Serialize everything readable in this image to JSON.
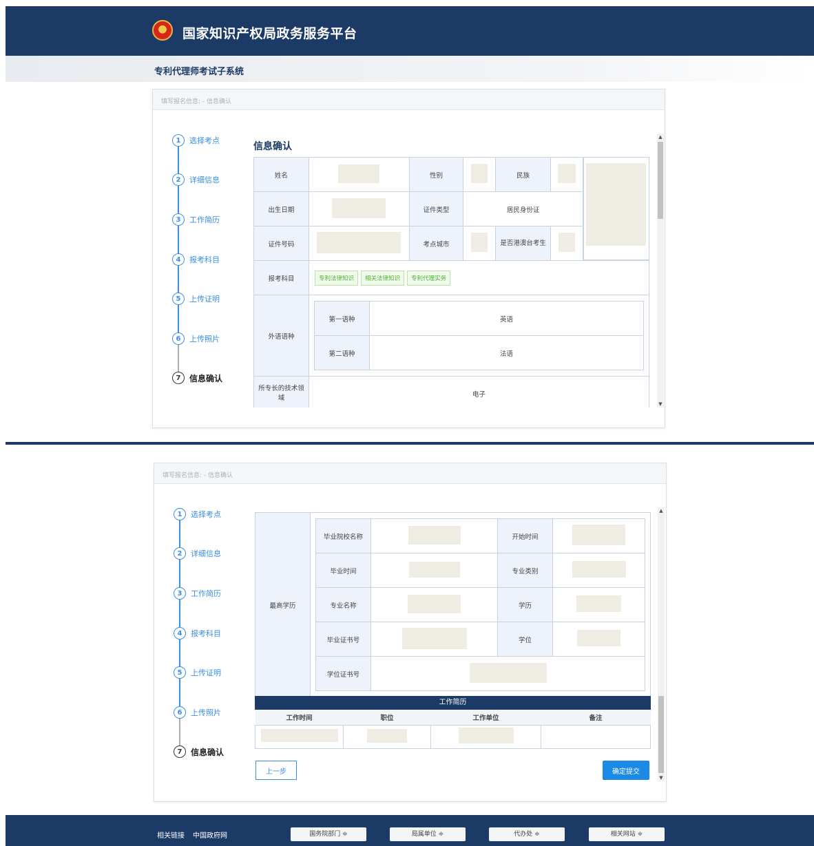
{
  "header": {
    "site_title": "国家知识产权局政务服务平台"
  },
  "subheader": {
    "system_title": "专利代理师考试子系统"
  },
  "breadcrumb": "填写报名信息: - 信息确认",
  "steps": [
    {
      "num": "1",
      "label": "选择考点"
    },
    {
      "num": "2",
      "label": "详细信息"
    },
    {
      "num": "3",
      "label": "工作简历"
    },
    {
      "num": "4",
      "label": "报考科目"
    },
    {
      "num": "5",
      "label": "上传证明"
    },
    {
      "num": "6",
      "label": "上传照片"
    },
    {
      "num": "7",
      "label": "信息确认"
    }
  ],
  "info": {
    "section_title": "信息确认",
    "name_label": "姓名",
    "gender_label": "性别",
    "ethnicity_label": "民族",
    "birth_label": "出生日期",
    "id_type_label": "证件类型",
    "id_type_value": "居民身份证",
    "id_no_label": "证件号码",
    "city_label": "考点城市",
    "hk_label": "是否港澳台考生",
    "subjects_label": "报考科目",
    "subjects": [
      "专利法律知识",
      "相关法律知识",
      "专利代理实务"
    ],
    "language_label": "外语语种",
    "lang1_label": "第一语种",
    "lang1_value": "英语",
    "lang2_label": "第二语种",
    "lang2_value": "法语",
    "tech_label": "所专长的技术领域",
    "tech_value": "电子"
  },
  "education": {
    "label": "最高学历",
    "school_label": "毕业院校名称",
    "start_label": "开始时间",
    "grad_time_label": "毕业时间",
    "major_type_label": "专业类别",
    "major_label": "专业名称",
    "edu_label": "学历",
    "cert_label": "毕业证书号",
    "degree_label": "学位",
    "degree_cert_label": "学位证书号"
  },
  "work": {
    "title": "工作简历",
    "columns": [
      "工作时间",
      "职位",
      "工作单位",
      "备注"
    ]
  },
  "actions": {
    "prev": "上一步",
    "submit": "确定提交"
  },
  "footer": {
    "links_label": "相关链接",
    "gov_site": "中国政府网",
    "selects": [
      "国务院部门 ≑",
      "局属单位 ≑",
      "代办处 ≑",
      "相关网站 ≑"
    ]
  }
}
